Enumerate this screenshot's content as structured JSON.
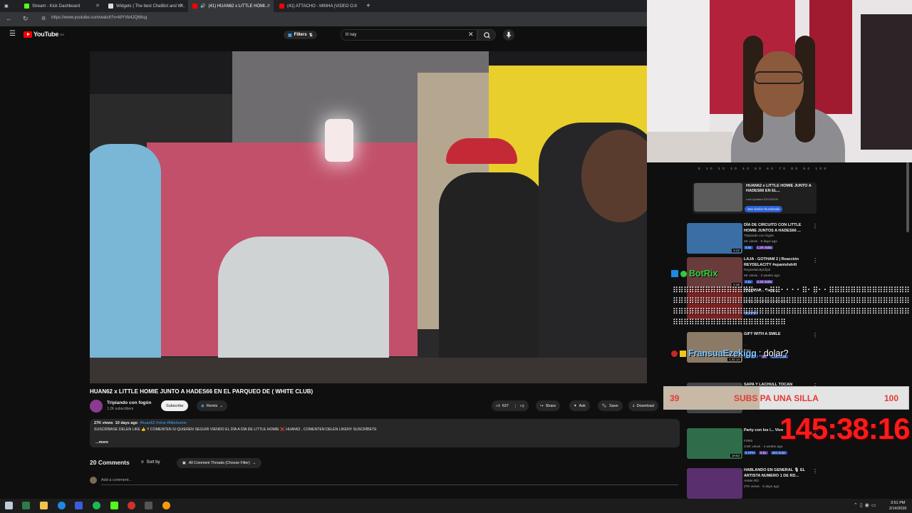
{
  "browser": {
    "tabs": [
      {
        "label": "Stream - Kick Dashboard",
        "color": "#53fc18"
      },
      {
        "label": "Widgets | The best ChatBot and W...",
        "color": "#dddddd"
      },
      {
        "label": "(41) HUAN62 x LITTLE HOMI...",
        "color": "#ff0000"
      },
      {
        "label": "(41) ATTACHO - MINHA (VIDEO O...",
        "color": "#ff0000"
      }
    ],
    "url": "https://www.youtube.com/watch?v=MYVb4JQ66sg"
  },
  "youtube": {
    "logo": "YouTube",
    "logo_region": "DO",
    "filters_label": "Filters",
    "search_value": "lil nay"
  },
  "video": {
    "title": "HUAN62 x LITTLE HOMIE JUNTO A HADES66 EN EL PARQUEO DE ( WHITE CLUB)",
    "channel": "Tripiando con fogón",
    "subscribers": "1.2K subscribers",
    "subscribe_label": "Subscribe",
    "remix_label": "Remix",
    "likes": "637",
    "share_label": "Share",
    "ask_label": "Ask",
    "save_label": "Save",
    "download_label": "Download",
    "views": "27K views",
    "age": "10 days ago",
    "tags": "#huan62 #viral #littlehomie",
    "description": "SUSCRÍBASE DELEN LIKE 👍 Y COMENTEN SI QUIEREN SEGUIR VIENDO EL DÍA A DÍA DE LITTLE HOMIE ❌ HUAN62 , COMENTEN DELEN LIKENY SUSCRÍBETE",
    "more_label": "...more"
  },
  "comments": {
    "count_label": "20 Comments",
    "sort_label": "Sort by",
    "filter_label": "All Comment Threads (Choose Filter)",
    "add_placeholder": "Add a comment..."
  },
  "sidebar": {
    "scale": "0 10 20 30 40 50 60 70 80 90 100",
    "current": {
      "title": "HUAN62 x LITTLE HOMIE JUNTO A HADES66 EN EL...",
      "subtitle": "Last Updated 02/04/2026",
      "button": "See similar thumbnails"
    },
    "recommendations": [
      {
        "title": "DÍA DE CIRCUITO CON LITTLE HOMIE JUNTOS A HADES66 ...",
        "channel": "Tripiando con fogón",
        "views": "4K views · 8 days ago",
        "stats": [
          "0.9x",
          "1.2K Subs"
        ],
        "duration": "6:22",
        "color": "#3b6ea5"
      },
      {
        "title": "LAJA - GOTHAM 2 | Reacción REYDELACITY #spanishdrill",
        "channel": "ReyDelaCityClips",
        "views": "6K views · 2 weeks ago",
        "stats": [
          "2.5x",
          "2.4K Subs"
        ],
        "duration": "5:46",
        "color": "#6a3b3b"
      },
      {
        "title": "PANAMA... Tiene...",
        "channel": "Kehbo_05 official musicvideo",
        "views": "",
        "stats": [
          "21 VPH"
        ],
        "duration": "",
        "color": "#7a2222"
      },
      {
        "title": "GIFT WITH A SMILE",
        "channel": "...",
        "views": "New",
        "stats": [
          "7K VPH",
          "2x",
          "1.8M Subs"
        ],
        "duration": "1:32:14",
        "color": "#8a7a66"
      },
      {
        "title": "SAPA Y LACHULL TOCAN PERSONALES POR U...",
        "channel": "",
        "views": "1 day ago",
        "stats": [
          "6I VPH"
        ],
        "duration": "",
        "color": "#444444"
      },
      {
        "title": "Party con los l... Vivo",
        "channel": "Frëk0",
        "views": "3.8K views · 4 weeks ago",
        "stats": [
          "8 VPH",
          "6.5x",
          "204 Subs"
        ],
        "duration": "19:53",
        "color": "#2f6d4a"
      },
      {
        "title": "HABLANDO EN GENERAL 🎙 EL ARTISTA NUMERO 1 DE RD...",
        "channel": "AeMe RD",
        "views": "27K views · 6 days ago",
        "stats": [],
        "duration": "",
        "color": "#5a2f6d"
      }
    ]
  },
  "overlay": {
    "bot_name": "BotRix",
    "spam": "⠿⠿⠿⠿⠿⠿⠿⠿⠿⠿⠿⠿⠿⠿⠿⠂⠂⠂⠿⠿⠂⠂⠂⠂⠿⠂⠿⠂⠂⠿⠿⠿⠿⠿⠿⠿⠿⠿⠿⠿⠿⠿⠿⠿⠿⠿⠿⠿⠿⠿⠿⠿⠿⠿⠿⠿⠿⠿⠿⠿⠿⠿⠿⠿⠿⠿⠿⠿⠿⠿⠿⠿⠿⠿⠿⠿⠿⠿⠿⠿⠿⠿⠿⠿⠿⠿⠿⠿⠿⠿⠿⠿⠿⠿⠿⠿⠿⠿⠿⠿⠿⠿⠿⠿⠿⠿⠿⠿⠿⠿⠿⠿⠿⠿⠿⠿⠿⠿⠿⠿⠿⠿⠿⠿⠿⠿⠿⠿⠿⠿⠿⠿⠿⠿⠿⠿⠿⠿⠿⠿⠿⠿⠿⠿⠿⠿⠿⠿⠿⠿⠿⠿⠿",
    "chat_user": "FransuaEzekigg",
    "chat_msg": ": dolar?",
    "goal_current": "39",
    "goal_label": "SUBS PA UNA SILLA",
    "goal_target": "100",
    "goal_fraction": 0.39,
    "timer": "145:38:16"
  },
  "taskbar": {
    "time": "3:51 PM",
    "date": "2/14/2026"
  }
}
